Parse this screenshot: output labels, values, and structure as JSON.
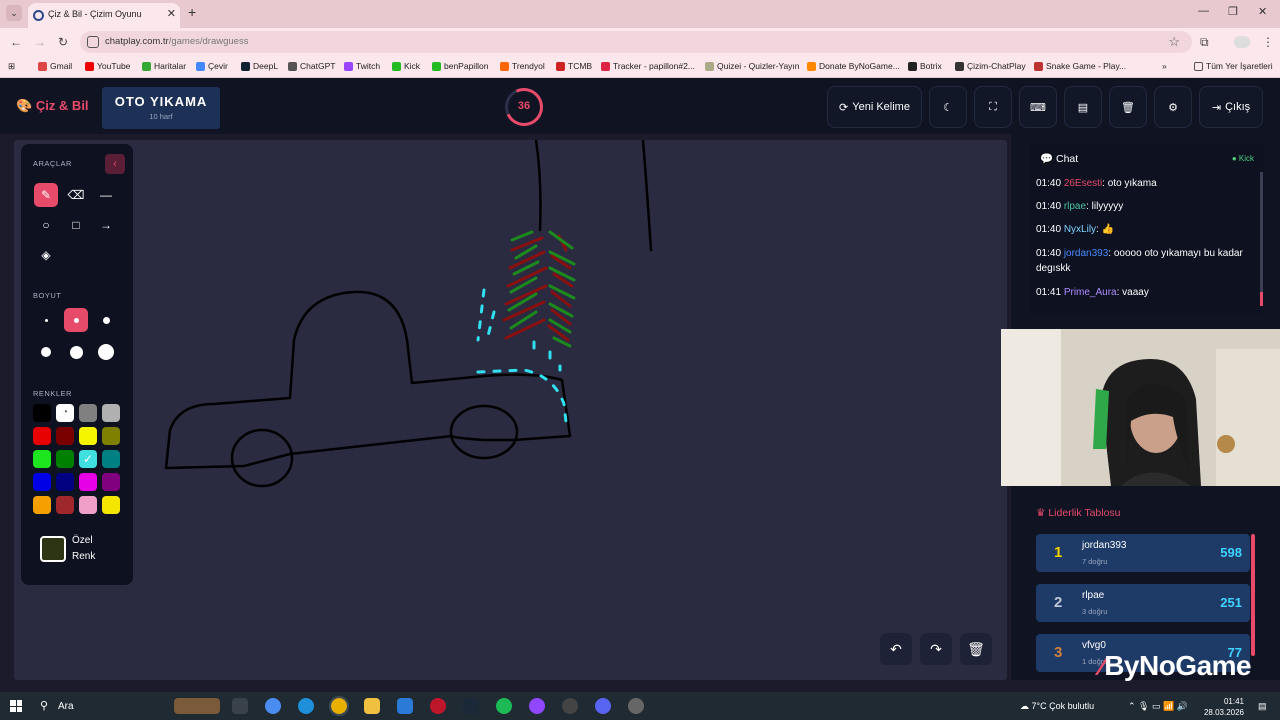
{
  "browser": {
    "tab_title": "Çiz & Bil - Çizim Oyunu",
    "url_host": "chatplay.com.tr",
    "url_path": "/games/drawguess",
    "bookmarks": [
      "Gmail",
      "YouTube",
      "Haritalar",
      "Çevir",
      "DeepL",
      "ChatGPT",
      "Twitch",
      "Kick",
      "benPapillon",
      "Trendyol",
      "TCMB",
      "Tracker - papillon#2...",
      "Quizei - Quizler-Yayın",
      "Donate ByNoGame...",
      "Botrix",
      "Çizim-ChatPlay",
      "Snake Game - Play..."
    ],
    "all_bookmarks": "Tüm Yer İşaretleri"
  },
  "header": {
    "logo": "Çiz & Bil",
    "word": "OTO YIKAMA",
    "word_length": "10 harf",
    "timer": "36",
    "new_word": "Yeni Kelime",
    "exit": "Çıkış"
  },
  "tools": {
    "section_tools": "ARAÇLAR",
    "section_size": "BOYUT",
    "section_colors": "RENKLER",
    "custom_color_label": "Özel Renk",
    "custom_color": "#2d3515",
    "colors": [
      "#000000",
      "#ffffff",
      "#808080",
      "#b0b0b0",
      "#e60000",
      "#7a0000",
      "#f5f500",
      "#808000",
      "#1ee61e",
      "#008000",
      "#40e0e0",
      "#008080",
      "#0000e6",
      "#000080",
      "#e600e6",
      "#800080",
      "#f5a000",
      "#a0282d",
      "#f0a0c8",
      "#f5e600"
    ],
    "selected_color_index": 10
  },
  "chat": {
    "title": "Chat",
    "status": "Kick",
    "messages": [
      {
        "time": "01:40",
        "user": "26Esesti",
        "user_color": "#e84a6a",
        "text": ": oto yıkama"
      },
      {
        "time": "01:40",
        "user": "rlpae",
        "user_color": "#4cc3a0",
        "text": ": lilyyyyy"
      },
      {
        "time": "01:40",
        "user": "NyxLily",
        "user_color": "#7fd4ff",
        "text": ": 👍"
      },
      {
        "time": "01:40",
        "user": "jordan393",
        "user_color": "#4a8cff",
        "text": ": ooooo oto yıkamayı bu kadar degıskk"
      },
      {
        "time": "01:41",
        "user": "Prime_Aura",
        "user_color": "#b08cff",
        "text": ": vaaay"
      }
    ]
  },
  "leaderboard": {
    "title": "Liderlik Tablosu",
    "rows": [
      {
        "rank": "1",
        "name": "jordan393",
        "correct": "7 doğru",
        "score": "598",
        "rank_color": "#f5d000"
      },
      {
        "rank": "2",
        "name": "rlpae",
        "correct": "3 doğru",
        "score": "251",
        "rank_color": "#c0c8d8"
      },
      {
        "rank": "3",
        "name": "vfvg0",
        "correct": "1 doğru",
        "score": "77",
        "rank_color": "#d08040"
      }
    ]
  },
  "watermark": "ByNoGame",
  "taskbar": {
    "search": "Ara",
    "weather": "7°C  Çok bulutlu",
    "time": "01:41",
    "date": "28.03.2026"
  }
}
